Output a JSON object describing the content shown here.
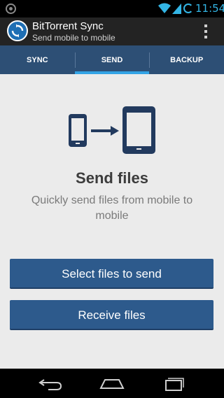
{
  "status": {
    "time": "11:54"
  },
  "app": {
    "title": "BitTorrent Sync",
    "subtitle": "Send mobile to mobile"
  },
  "tabs": [
    {
      "label": "SYNC",
      "active": false
    },
    {
      "label": "SEND",
      "active": true
    },
    {
      "label": "BACKUP",
      "active": false
    }
  ],
  "send": {
    "heading": "Send files",
    "description": "Quickly send files from mobile to mobile",
    "select_button": "Select files to send",
    "receive_button": "Receive files"
  },
  "colors": {
    "accent": "#33b5e5",
    "tab_bar": "#2d4f75",
    "button": "#2d5a8c",
    "background": "#ebebeb"
  }
}
